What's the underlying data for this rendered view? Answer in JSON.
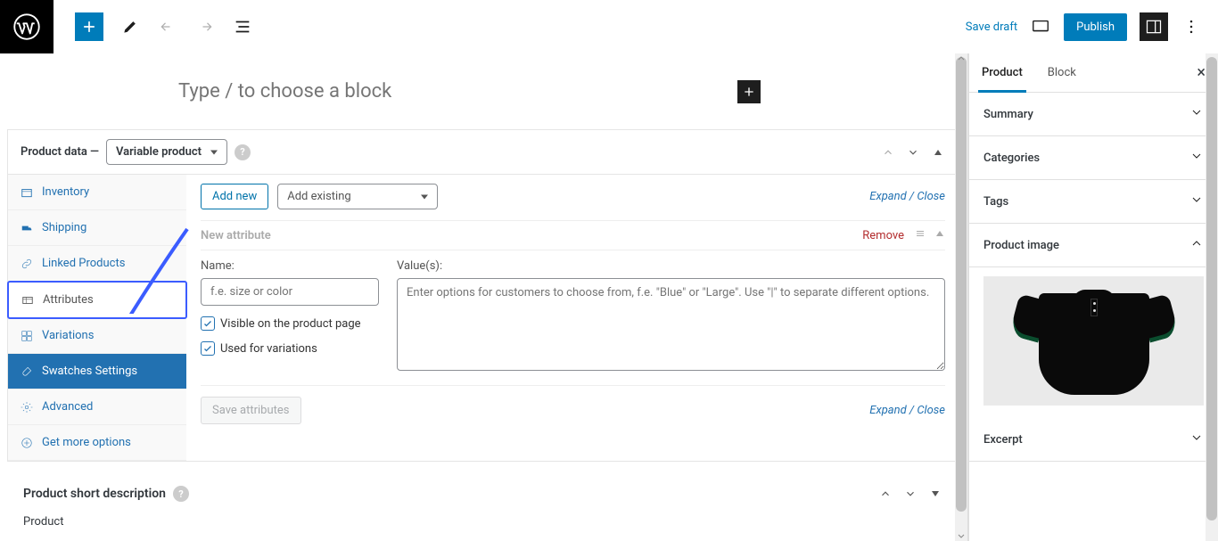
{
  "topbar": {
    "save_draft": "Save draft",
    "publish": "Publish"
  },
  "editor": {
    "block_placeholder": "Type / to choose a block"
  },
  "product_data": {
    "label": "Product data —",
    "selected_type": "Variable product",
    "tabs": {
      "inventory": "Inventory",
      "shipping": "Shipping",
      "linked": "Linked Products",
      "attributes": "Attributes",
      "variations": "Variations",
      "swatches": "Swatches Settings",
      "advanced": "Advanced",
      "more": "Get more options"
    },
    "attr_panel": {
      "add_new": "Add new",
      "add_existing_placeholder": "Add existing",
      "expand_collapse": "Expand / Close",
      "new_attribute_title": "New attribute",
      "remove": "Remove",
      "name_label": "Name:",
      "name_placeholder": "f.e. size or color",
      "values_label": "Value(s):",
      "values_placeholder": "Enter options for customers to choose from, f.e. \"Blue\" or \"Large\". Use \"|\" to separate different options.",
      "visible_label": "Visible on the product page",
      "used_for_variations_label": "Used for variations",
      "save_attributes": "Save attributes"
    }
  },
  "short_description": {
    "title": "Product short description"
  },
  "bottom_note": "Product",
  "sidebar": {
    "tabs": {
      "product": "Product",
      "block": "Block"
    },
    "sections": {
      "summary": "Summary",
      "categories": "Categories",
      "tags": "Tags",
      "product_image": "Product image",
      "excerpt": "Excerpt"
    }
  }
}
